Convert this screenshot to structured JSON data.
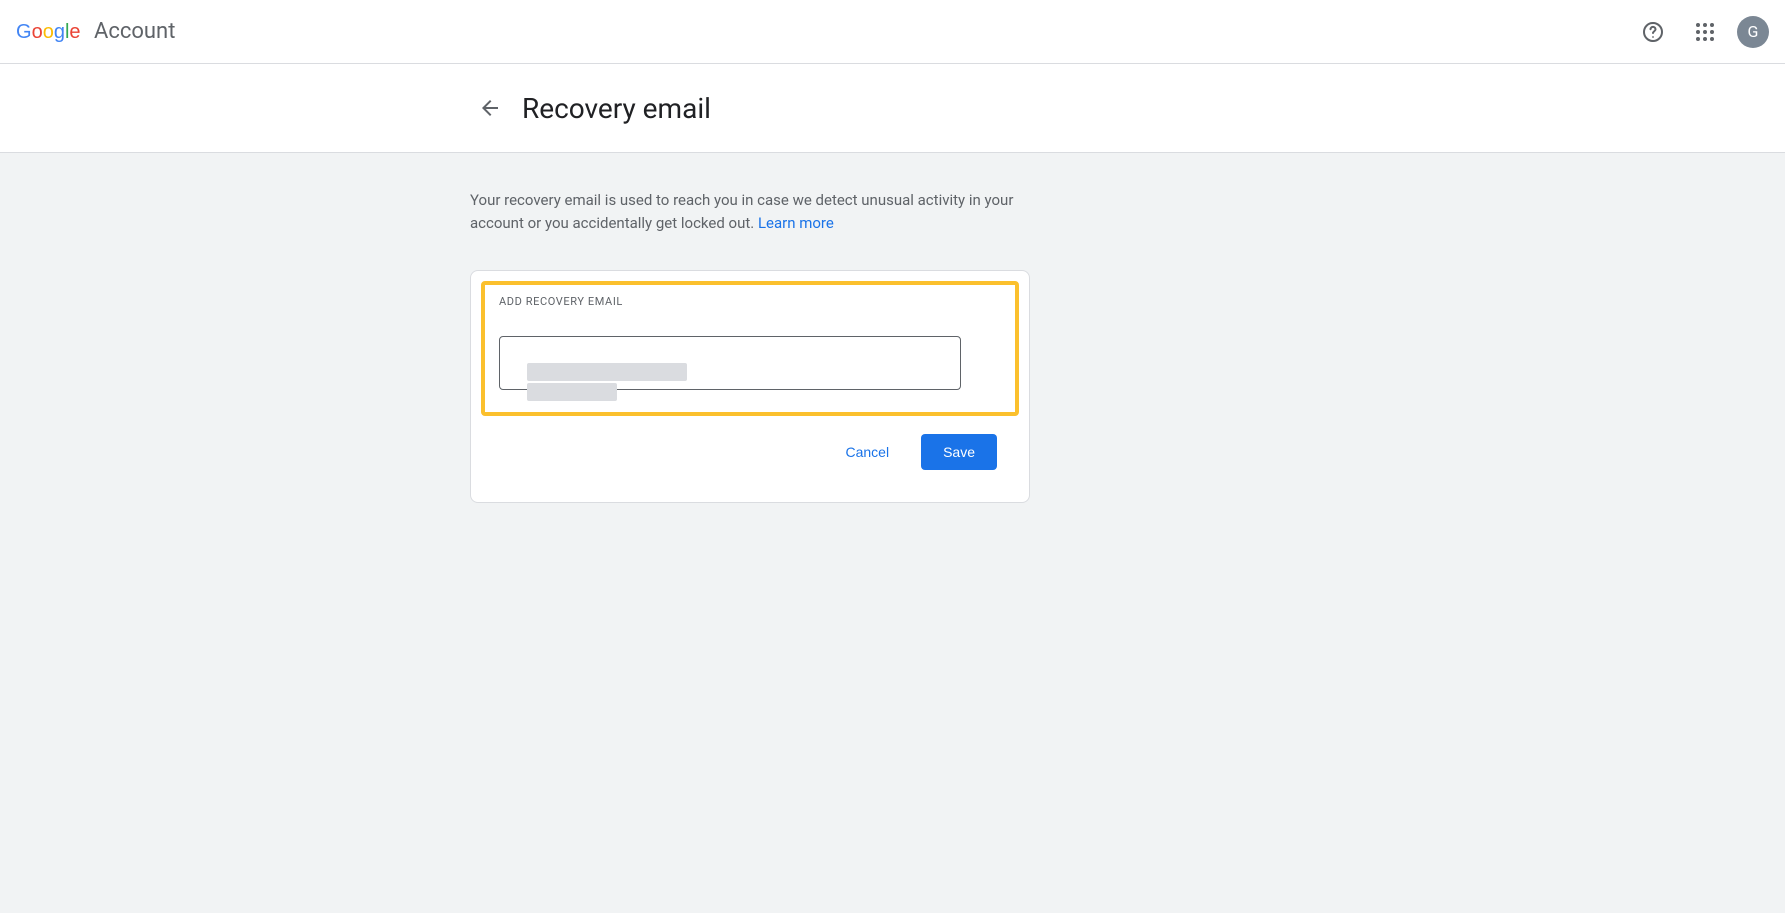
{
  "header": {
    "product": "Account",
    "avatar_initial": "G"
  },
  "page": {
    "title": "Recovery email",
    "description_1": "Your recovery email is used to reach you in case we detect unusual activity in your account or you accidentally get locked out. ",
    "learn_more": "Learn more"
  },
  "form": {
    "section_label": "ADD RECOVERY EMAIL",
    "input_value": "",
    "cancel_label": "Cancel",
    "save_label": "Save"
  },
  "colors": {
    "accent": "#1a73e8",
    "focus_ring": "#fbc02d",
    "surface": "#f1f3f4",
    "border": "#dadce0",
    "text_secondary": "#5f6368"
  }
}
